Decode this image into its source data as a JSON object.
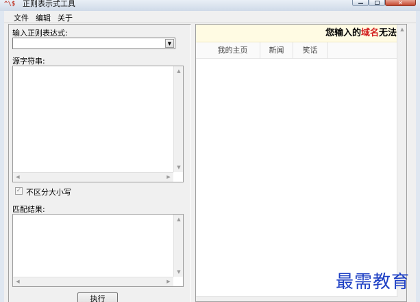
{
  "window": {
    "title": "正则表示式工具",
    "icon_text": "^\\$",
    "close_glyph": "✕"
  },
  "menu": [
    "文件",
    "编辑",
    "关于"
  ],
  "left": {
    "regex_label": "输入正则表达式:",
    "regex_value": "",
    "source_label": "源字符串:",
    "ignore_case_label": "不区分大小写",
    "ignore_case_checked": true,
    "result_label": "匹配结果:",
    "execute_label": "执行"
  },
  "right": {
    "notice_prefix": "您输入的",
    "notice_highlight": "域名",
    "notice_suffix": "无法",
    "tabs": [
      "我的主页",
      "新闻",
      "笑话"
    ]
  },
  "watermark": "最需教育",
  "colors": {
    "notice_bg": "#fffbe3",
    "notice_highlight": "#d32020",
    "watermark": "#1d3fc4"
  }
}
